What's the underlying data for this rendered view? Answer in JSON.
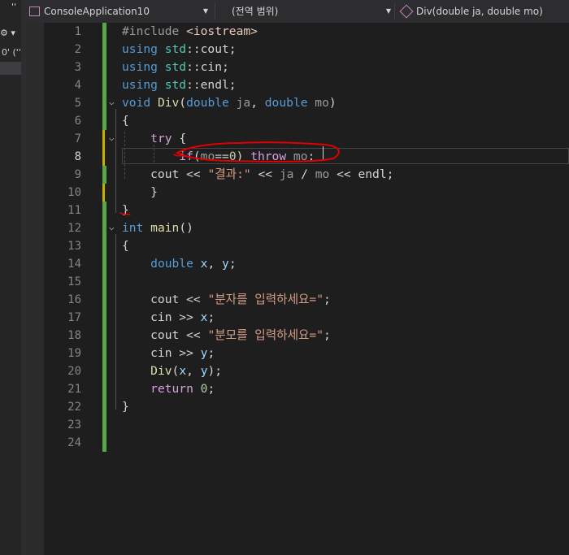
{
  "navbar": {
    "project": "ConsoleApplication10",
    "scope": "(전역 범위)",
    "member": "Div(double ja, double mo)"
  },
  "sidebar_fragments": [
    "''",
    "0' (''"
  ],
  "editor": {
    "current_line": 8,
    "lines": [
      {
        "n": "1",
        "tokens": [
          [
            "pp",
            "#include "
          ],
          [
            "inc",
            "<iostream>"
          ]
        ]
      },
      {
        "n": "2",
        "tokens": [
          [
            "kw",
            "using "
          ],
          [
            "ns",
            "std"
          ],
          [
            "plain",
            "::cout;"
          ]
        ]
      },
      {
        "n": "3",
        "tokens": [
          [
            "kw",
            "using "
          ],
          [
            "ns",
            "std"
          ],
          [
            "plain",
            "::cin;"
          ]
        ]
      },
      {
        "n": "4",
        "tokens": [
          [
            "kw",
            "using "
          ],
          [
            "ns",
            "std"
          ],
          [
            "plain",
            "::endl;"
          ]
        ]
      },
      {
        "n": "5",
        "tokens": [
          [
            "kw",
            "void "
          ],
          [
            "fn",
            "Div"
          ],
          [
            "plain",
            "("
          ],
          [
            "kw",
            "double "
          ],
          [
            "par",
            "ja"
          ],
          [
            "plain",
            ", "
          ],
          [
            "kw",
            "double "
          ],
          [
            "par",
            "mo"
          ],
          [
            "plain",
            ")"
          ]
        ]
      },
      {
        "n": "6",
        "tokens": [
          [
            "plain",
            "{"
          ]
        ]
      },
      {
        "n": "7",
        "tokens": [
          [
            "plain",
            "    "
          ],
          [
            "ctl",
            "try "
          ],
          [
            "plain",
            "{"
          ]
        ]
      },
      {
        "n": "8",
        "tokens": [
          [
            "plain",
            "        "
          ],
          [
            "ctl",
            "if"
          ],
          [
            "plain",
            "("
          ],
          [
            "par",
            "mo"
          ],
          [
            "plain",
            "=="
          ],
          [
            "num",
            "0"
          ],
          [
            "plain",
            ") "
          ],
          [
            "ctl",
            "throw "
          ],
          [
            "par",
            "mo"
          ],
          [
            "plain",
            ";"
          ]
        ]
      },
      {
        "n": "9",
        "tokens": [
          [
            "plain",
            "    cout "
          ],
          [
            "plain",
            "<< "
          ],
          [
            "str",
            "\"결과:\""
          ],
          [
            "plain",
            " << "
          ],
          [
            "par",
            "ja"
          ],
          [
            "plain",
            " / "
          ],
          [
            "par",
            "mo"
          ],
          [
            "plain",
            " << endl;"
          ]
        ]
      },
      {
        "n": "10",
        "tokens": [
          [
            "plain",
            "    }"
          ]
        ]
      },
      {
        "n": "11",
        "tokens": [
          [
            "plain",
            "}"
          ]
        ]
      },
      {
        "n": "12",
        "tokens": [
          [
            "kw",
            "int "
          ],
          [
            "fn",
            "main"
          ],
          [
            "plain",
            "()"
          ]
        ]
      },
      {
        "n": "13",
        "tokens": [
          [
            "plain",
            "{"
          ]
        ]
      },
      {
        "n": "14",
        "tokens": [
          [
            "plain",
            "    "
          ],
          [
            "kw",
            "double "
          ],
          [
            "ident",
            "x"
          ],
          [
            "plain",
            ", "
          ],
          [
            "ident",
            "y"
          ],
          [
            "plain",
            ";"
          ]
        ]
      },
      {
        "n": "15",
        "tokens": []
      },
      {
        "n": "16",
        "tokens": [
          [
            "plain",
            "    cout << "
          ],
          [
            "str",
            "\"분자를 입력하세요=\""
          ],
          [
            "plain",
            ";"
          ]
        ]
      },
      {
        "n": "17",
        "tokens": [
          [
            "plain",
            "    cin >> "
          ],
          [
            "ident",
            "x"
          ],
          [
            "plain",
            ";"
          ]
        ]
      },
      {
        "n": "18",
        "tokens": [
          [
            "plain",
            "    cout << "
          ],
          [
            "str",
            "\"분모를 입력하세요=\""
          ],
          [
            "plain",
            ";"
          ]
        ]
      },
      {
        "n": "19",
        "tokens": [
          [
            "plain",
            "    cin >> "
          ],
          [
            "ident",
            "y"
          ],
          [
            "plain",
            ";"
          ]
        ]
      },
      {
        "n": "20",
        "tokens": [
          [
            "plain",
            "    "
          ],
          [
            "fn",
            "Div"
          ],
          [
            "plain",
            "("
          ],
          [
            "ident",
            "x"
          ],
          [
            "plain",
            ", "
          ],
          [
            "ident",
            "y"
          ],
          [
            "plain",
            ");"
          ]
        ]
      },
      {
        "n": "21",
        "tokens": [
          [
            "plain",
            "    "
          ],
          [
            "ctl",
            "return "
          ],
          [
            "num",
            "0"
          ],
          [
            "plain",
            ";"
          ]
        ]
      },
      {
        "n": "22",
        "tokens": [
          [
            "plain",
            "}"
          ]
        ]
      },
      {
        "n": "23",
        "tokens": []
      },
      {
        "n": "24",
        "tokens": []
      }
    ]
  },
  "colors": {
    "keyword": "#569cd6",
    "control": "#d8a0df",
    "function": "#dcdcaa",
    "string": "#d69d85",
    "number": "#b5cea8",
    "change_saved": "#57a64a",
    "change_unsaved": "#c5b000",
    "annotation": "#e00000"
  }
}
